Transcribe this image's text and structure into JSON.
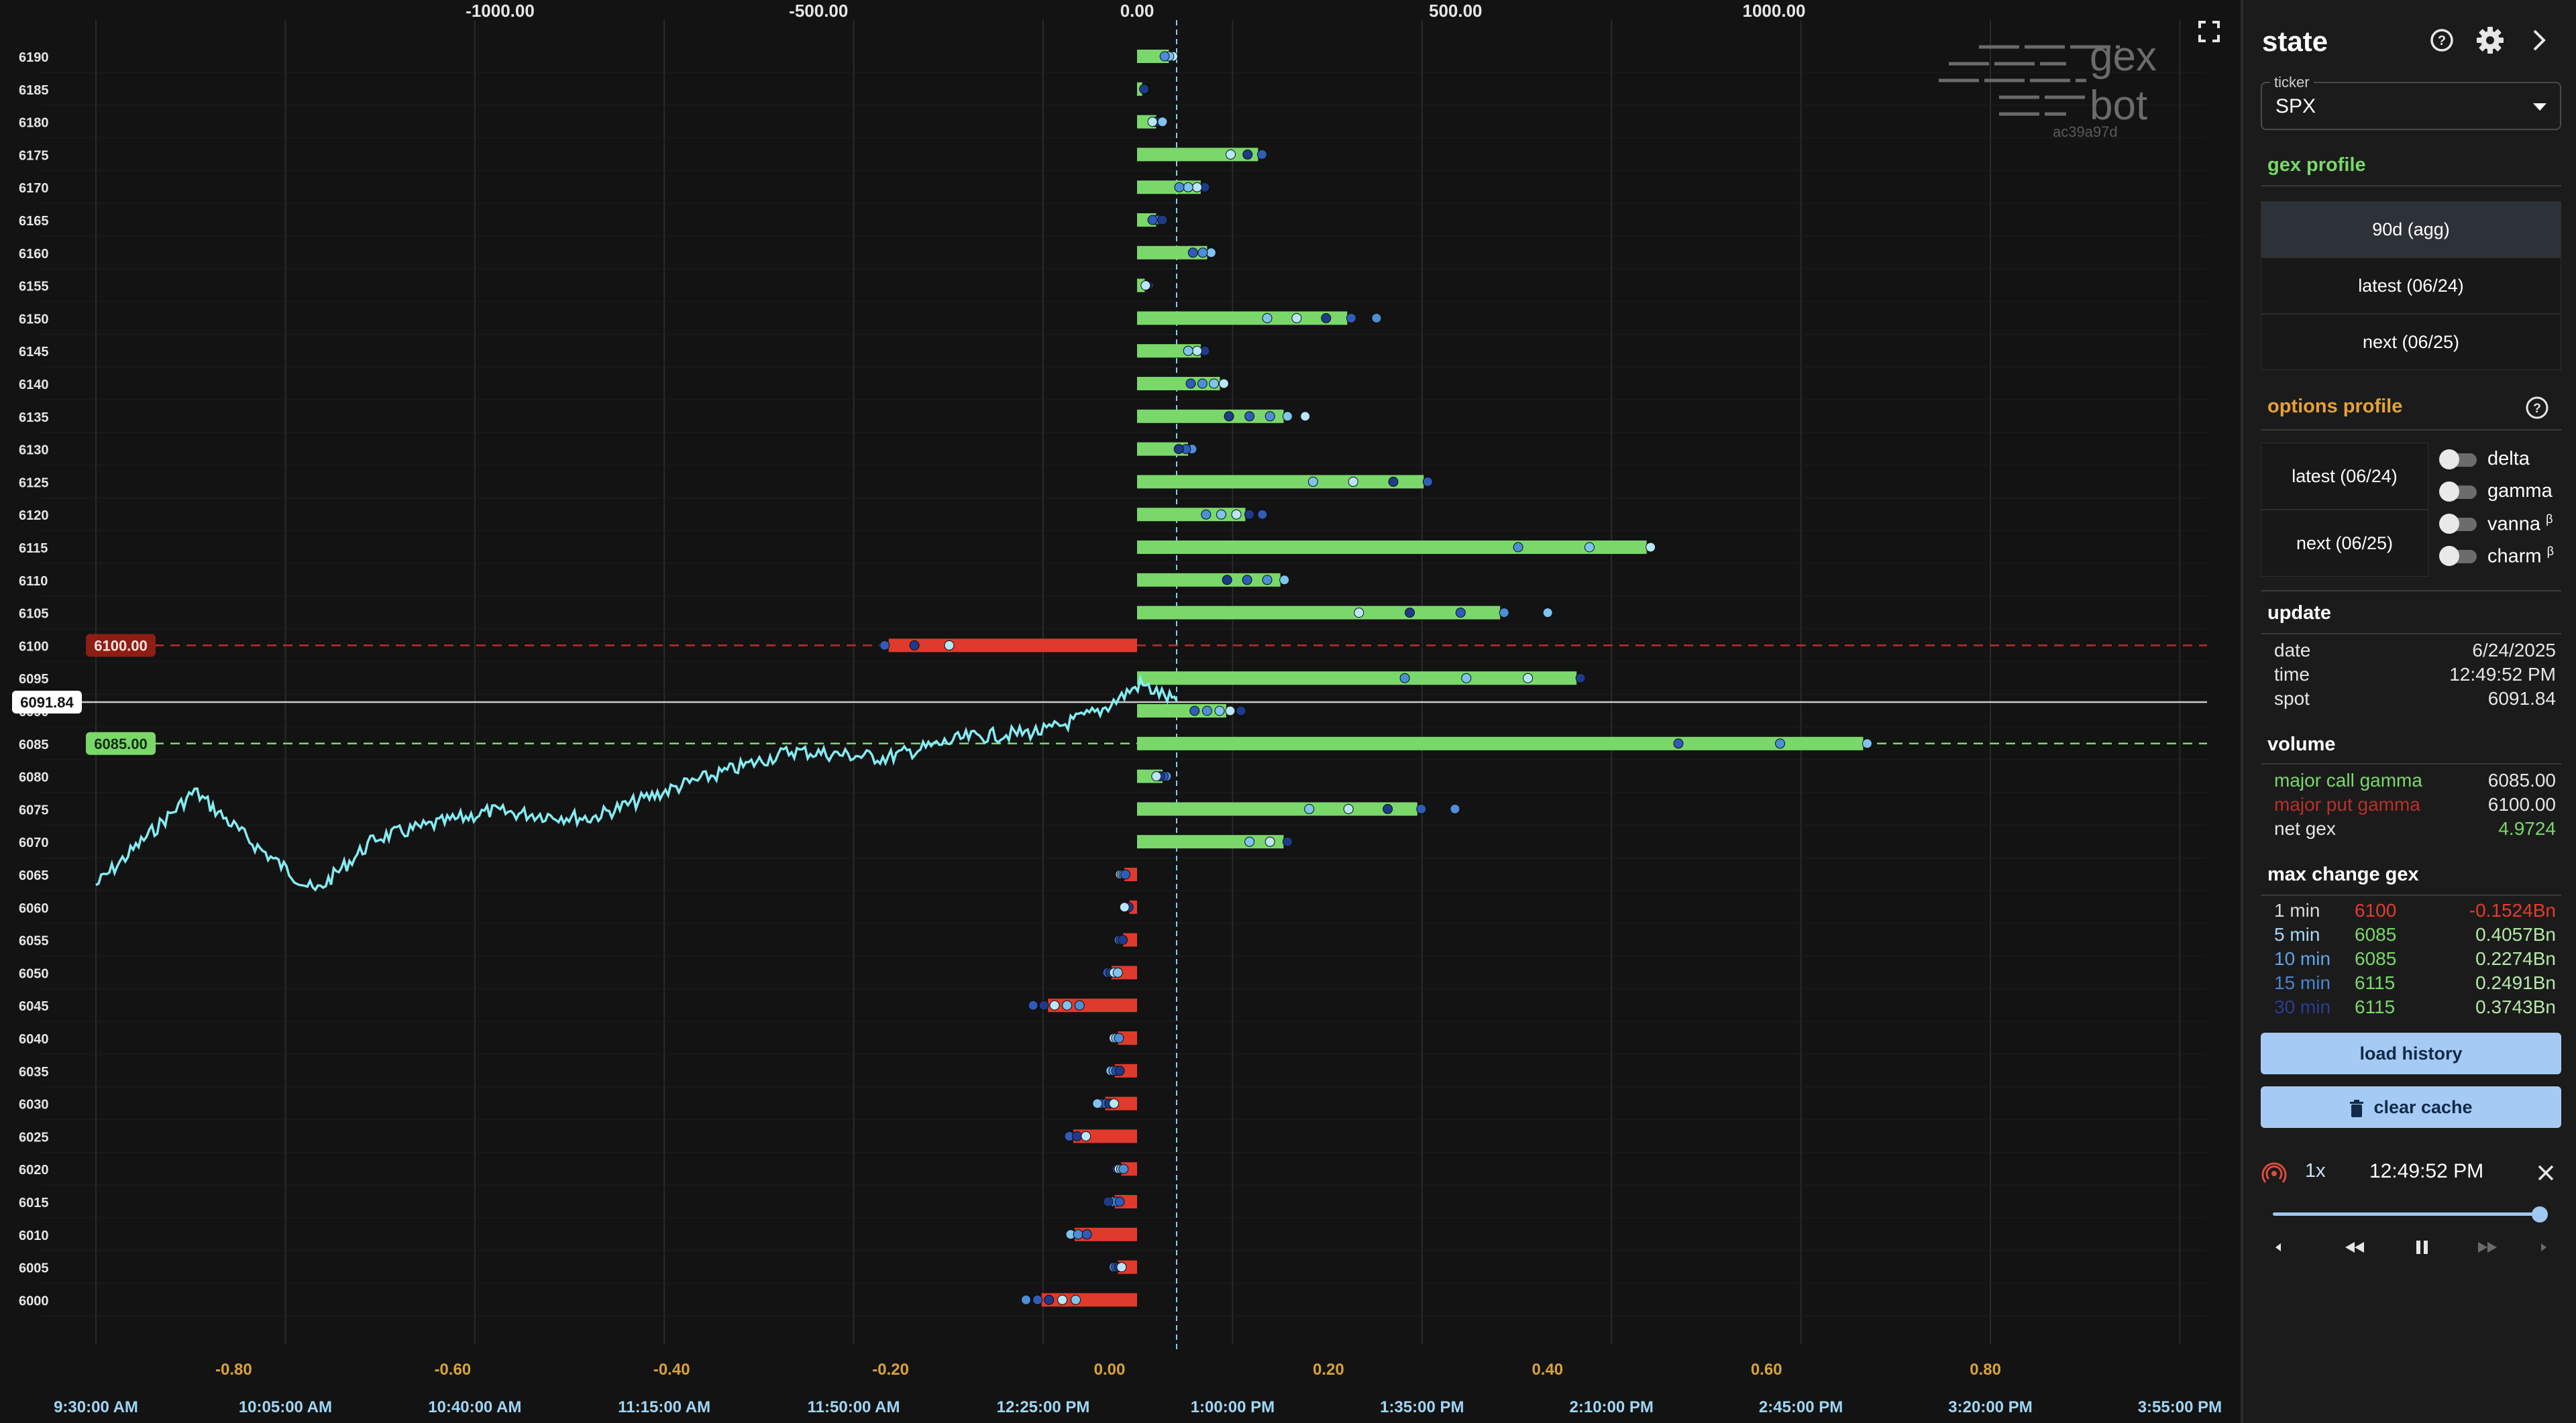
{
  "chart": {
    "gex_axis_ticks": [
      "-1000.00",
      "-500.00",
      "0.00",
      "500.00",
      "1000.00"
    ],
    "gex_axis_values": [
      -1000,
      -500,
      0,
      500,
      1000
    ],
    "bottom_axis_ticks": [
      "-0.80",
      "-0.60",
      "-0.40",
      "-0.20",
      "0.00",
      "0.20",
      "0.40",
      "0.60",
      "0.80"
    ],
    "bottom_axis_values": [
      -0.8,
      -0.6,
      -0.4,
      -0.2,
      0,
      0.2,
      0.4,
      0.6,
      0.8
    ],
    "time_ticks": [
      "9:30:00 AM",
      "10:05:00 AM",
      "10:40:00 AM",
      "11:15:00 AM",
      "11:50:00 AM",
      "12:25:00 PM",
      "1:00:00 PM",
      "1:35:00 PM",
      "2:10:00 PM",
      "2:45:00 PM",
      "3:20:00 PM",
      "3:55:00 PM"
    ],
    "strikes": [
      6190,
      6185,
      6180,
      6175,
      6170,
      6165,
      6160,
      6155,
      6150,
      6145,
      6140,
      6135,
      6130,
      6125,
      6120,
      6115,
      6110,
      6105,
      6100,
      6095,
      6090,
      6085,
      6080,
      6075,
      6070,
      6065,
      6060,
      6055,
      6050,
      6045,
      6040,
      6035,
      6030,
      6025,
      6020,
      6015,
      6010,
      6005,
      6000
    ],
    "gex_values": [
      50,
      8,
      30,
      190,
      100,
      30,
      110,
      12,
      330,
      100,
      130,
      230,
      80,
      450,
      170,
      800,
      225,
      570,
      -390,
      690,
      140,
      1140,
      40,
      440,
      230,
      -20,
      -12,
      -22,
      -40,
      -140,
      -30,
      -35,
      -50,
      -100,
      -25,
      -35,
      -98,
      -30,
      -150
    ],
    "major_call_gamma_label": "6085.00",
    "major_put_gamma_label": "6100.00",
    "spot_label": "6091.84",
    "watermark_line1": "gex",
    "watermark_line2": "bot",
    "watermark_id": "ac39a97d",
    "colors": {
      "call": "#7ad86a",
      "put": "#e03a2c",
      "price": "#84ecf2",
      "spot": "#cccccc"
    }
  },
  "panel": {
    "title": "state",
    "ticker_label": "ticker",
    "ticker_value": "SPX",
    "gex_profile_title": "gex profile",
    "gex_profile_options": [
      "90d (agg)",
      "latest (06/24)",
      "next (06/25)"
    ],
    "options_profile_title": "options profile",
    "options_profile_buttons": [
      "latest (06/24)",
      "next (06/25)"
    ],
    "toggles": [
      "delta",
      "gamma",
      "vanna",
      "charm"
    ],
    "beta": "β",
    "update_title": "update",
    "update": {
      "date_label": "date",
      "date": "6/24/2025",
      "time_label": "time",
      "time": "12:49:52 PM",
      "spot_label": "spot",
      "spot": "6091.84"
    },
    "volume_title": "volume",
    "volume": {
      "call_label": "major call gamma",
      "call": "6085.00",
      "put_label": "major put gamma",
      "put": "6100.00",
      "net_label": "net gex",
      "net": "4.9724"
    },
    "max_change_title": "max change gex",
    "max_change": [
      {
        "interval": "1 min",
        "strike": "6100",
        "value": "-0.1524Bn",
        "color": "#d8d8d8",
        "strike_color": "#e53b2c",
        "value_color": "#e53b2c"
      },
      {
        "interval": "5 min",
        "strike": "6085",
        "value": "0.4057Bn",
        "color": "#a8d7f5",
        "strike_color": "#7ad86a",
        "value_color": "#b6e7a8"
      },
      {
        "interval": "10 min",
        "strike": "6085",
        "value": "0.2274Bn",
        "color": "#5fa4e6",
        "strike_color": "#7ad86a",
        "value_color": "#b6e7a8"
      },
      {
        "interval": "15 min",
        "strike": "6115",
        "value": "0.2491Bn",
        "color": "#4a83cf",
        "strike_color": "#7ad86a",
        "value_color": "#b6e7a8"
      },
      {
        "interval": "30 min",
        "strike": "6115",
        "value": "0.3743Bn",
        "color": "#2a3e92",
        "strike_color": "#7ad86a",
        "value_color": "#b6e7a8"
      }
    ],
    "load_history": "load history",
    "clear_cache": "clear cache",
    "player": {
      "speed": "1x",
      "time": "12:49:52 PM",
      "progress": 1.0
    }
  }
}
